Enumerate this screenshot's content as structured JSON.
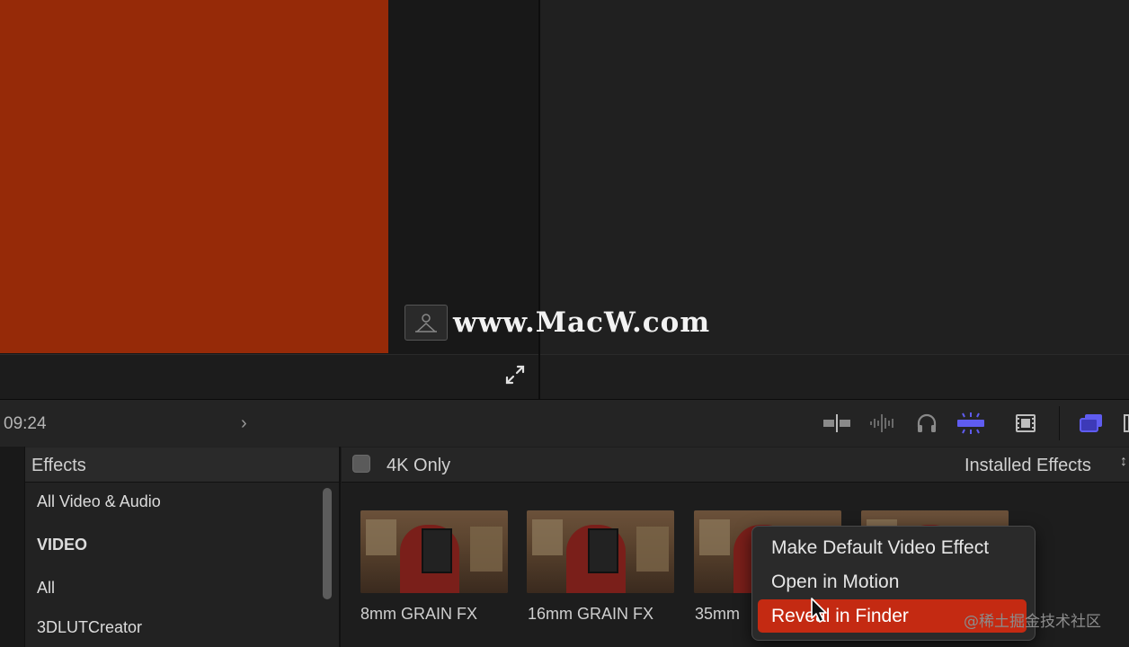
{
  "watermark": {
    "text": "www.MacW.com"
  },
  "toolbar": {
    "timecode": "09:24",
    "icons": [
      "clip-appearance-icon",
      "audio-waveform-icon",
      "headphones-icon",
      "snapping-icon",
      "filmstrip-icon",
      "browser-toggle-icon"
    ],
    "accent_color": "#5f5cf0"
  },
  "sidebar": {
    "title": "Effects",
    "items": [
      {
        "label": "All Video & Audio"
      },
      {
        "label": "VIDEO"
      },
      {
        "label": "All"
      },
      {
        "label": "3DLUTCreator"
      }
    ]
  },
  "content": {
    "fourk_label": "4K Only",
    "filter_label": "Installed Effects",
    "thumbnails": [
      {
        "label": "8mm GRAIN FX"
      },
      {
        "label": "16mm GRAIN FX"
      },
      {
        "label": "35mm"
      },
      {
        "label": ""
      }
    ]
  },
  "context_menu": {
    "items": [
      {
        "label": "Make Default Video Effect"
      },
      {
        "label": "Open in Motion"
      },
      {
        "label": "Reveal in Finder"
      }
    ],
    "highlight_color": "#c42a12"
  },
  "site_watermark": "@稀土掘金技术社区",
  "colors": {
    "viewer_frame": "#962a08"
  }
}
